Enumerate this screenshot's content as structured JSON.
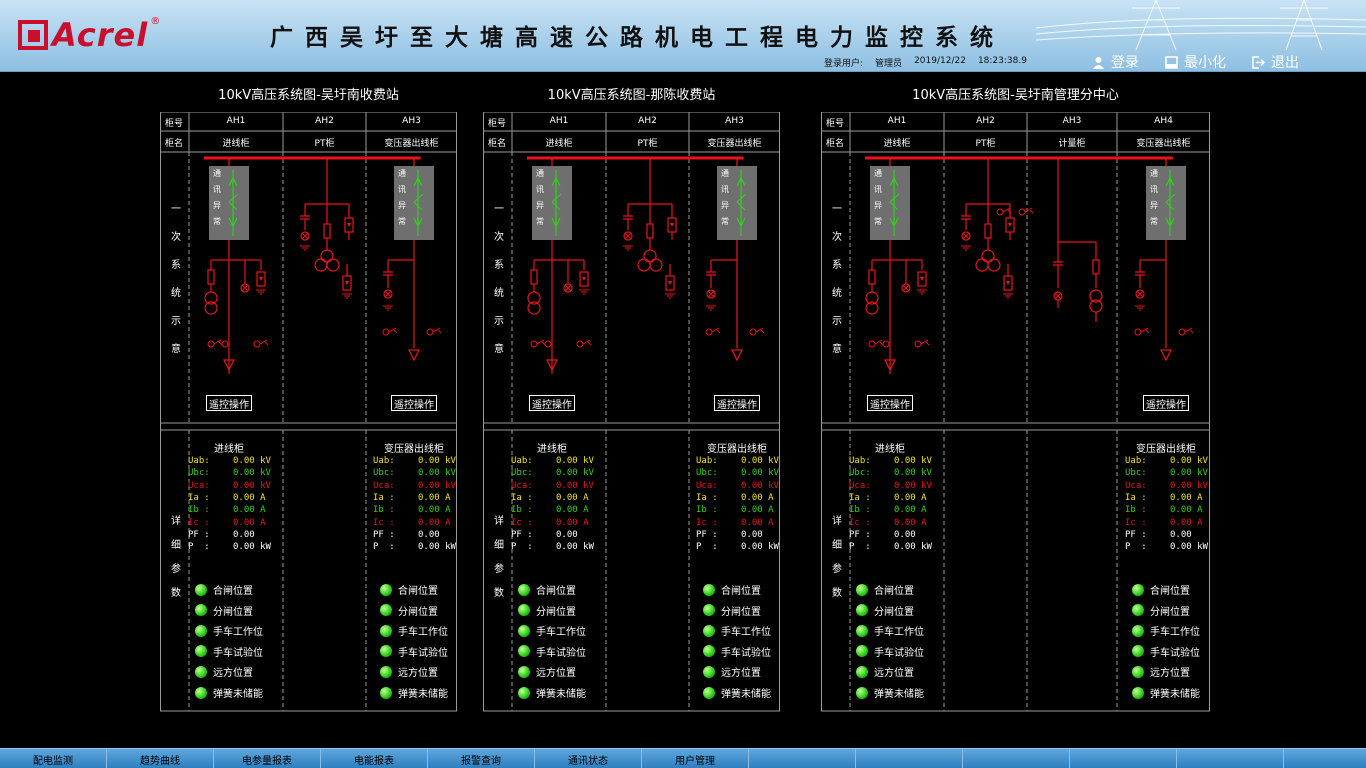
{
  "header": {
    "logo_text": "Acrel",
    "logo_reg": "®",
    "title": "广西吴圩至大塘高速公路机电工程电力监控系统",
    "login_label": "登录用户:",
    "login_user": "管理员",
    "date": "2019/12/22",
    "time": "18:23:38.9",
    "btn_login": "登录",
    "btn_minimize": "最小化",
    "btn_exit": "退出"
  },
  "colors": {
    "line": "#e8141c",
    "measGreen": "#2fd21a",
    "ledGreen": "#2fd21a",
    "accent": "#c8102e",
    "nav": "#2e7fc0"
  },
  "common": {
    "row_cabinet_no": "柜号",
    "row_cabinet_name": "柜名",
    "primary_label": [
      "一",
      "次",
      "系",
      "统",
      "示",
      "意"
    ],
    "detail_label": [
      "详",
      "细",
      "参",
      "数"
    ],
    "comm_fault": [
      "通",
      "讯",
      "异",
      "常"
    ],
    "remote_btn": "遥控操作"
  },
  "panels": [
    {
      "title": "10kV高压系统图-吴圩南收费站",
      "cabinets": [
        {
          "no": "AH1",
          "name": "进线柜"
        },
        {
          "no": "AH2",
          "name": "PT柜"
        },
        {
          "no": "AH3",
          "name": "变压器出线柜"
        }
      ],
      "details": [
        {
          "title": "进线柜",
          "meas": [
            {
              "label": "Uab:",
              "value": "0.00 kV"
            },
            {
              "label": "Ubc:",
              "value": "0.00 kV"
            },
            {
              "label": "Uca:",
              "value": "0.00 kV"
            },
            {
              "label": "Ia :",
              "value": "0.00 A"
            },
            {
              "label": "Ib :",
              "value": "0.00 A"
            },
            {
              "label": "Ic :",
              "value": "0.00 A"
            },
            {
              "label": "PF :",
              "value": "0.00"
            },
            {
              "label": "P  :",
              "value": "0.00 kW"
            }
          ],
          "status": [
            "合闸位置",
            "分闸位置",
            "手车工作位",
            "手车试验位",
            "远方位置",
            "弹簧未储能"
          ]
        },
        {
          "title": "变压器出线柜",
          "meas": [
            {
              "label": "Uab:",
              "value": "0.00 kV"
            },
            {
              "label": "Ubc:",
              "value": "0.00 kV"
            },
            {
              "label": "Uca:",
              "value": "0.00 kV"
            },
            {
              "label": "Ia :",
              "value": "0.00 A"
            },
            {
              "label": "Ib :",
              "value": "0.00 A"
            },
            {
              "label": "Ic :",
              "value": "0.00 A"
            },
            {
              "label": "PF :",
              "value": "0.00"
            },
            {
              "label": "P  :",
              "value": "0.00 kW"
            }
          ],
          "status": [
            "合闸位置",
            "分闸位置",
            "手车工作位",
            "手车试验位",
            "远方位置",
            "弹簧未储能"
          ]
        }
      ]
    },
    {
      "title": "10kV高压系统图-那陈收费站",
      "cabinets": [
        {
          "no": "AH1",
          "name": "进线柜"
        },
        {
          "no": "AH2",
          "name": "PT柜"
        },
        {
          "no": "AH3",
          "name": "变压器出线柜"
        }
      ],
      "details": [
        {
          "title": "进线柜",
          "meas": [
            {
              "label": "Uab:",
              "value": "0.00 kV"
            },
            {
              "label": "Ubc:",
              "value": "0.00 kV"
            },
            {
              "label": "Uca:",
              "value": "0.00 kV"
            },
            {
              "label": "Ia :",
              "value": "0.00 A"
            },
            {
              "label": "Ib :",
              "value": "0.00 A"
            },
            {
              "label": "Ic :",
              "value": "0.00 A"
            },
            {
              "label": "PF :",
              "value": "0.00"
            },
            {
              "label": "P  :",
              "value": "0.00 kW"
            }
          ],
          "status": [
            "合闸位置",
            "分闸位置",
            "手车工作位",
            "手车试验位",
            "远方位置",
            "弹簧未储能"
          ]
        },
        {
          "title": "变压器出线柜",
          "meas": [
            {
              "label": "Uab:",
              "value": "0.00 kV"
            },
            {
              "label": "Ubc:",
              "value": "0.00 kV"
            },
            {
              "label": "Uca:",
              "value": "0.00 kV"
            },
            {
              "label": "Ia :",
              "value": "0.00 A"
            },
            {
              "label": "Ib :",
              "value": "0.00 A"
            },
            {
              "label": "Ic :",
              "value": "0.00 A"
            },
            {
              "label": "PF :",
              "value": "0.00"
            },
            {
              "label": "P  :",
              "value": "0.00 kW"
            }
          ],
          "status": [
            "合闸位置",
            "分闸位置",
            "手车工作位",
            "手车试验位",
            "远方位置",
            "弹簧未储能"
          ]
        }
      ]
    },
    {
      "title": "10kV高压系统图-吴圩南管理分中心",
      "cabinets": [
        {
          "no": "AH1",
          "name": "进线柜"
        },
        {
          "no": "AH2",
          "name": "PT柜"
        },
        {
          "no": "AH3",
          "name": "计量柜"
        },
        {
          "no": "AH4",
          "name": "变压器出线柜"
        }
      ],
      "details": [
        {
          "title": "进线柜",
          "meas": [
            {
              "label": "Uab:",
              "value": "0.00 kV"
            },
            {
              "label": "Ubc:",
              "value": "0.00 kV"
            },
            {
              "label": "Uca:",
              "value": "0.00 kV"
            },
            {
              "label": "Ia :",
              "value": "0.00 A"
            },
            {
              "label": "Ib :",
              "value": "0.00 A"
            },
            {
              "label": "Ic :",
              "value": "0.00 A"
            },
            {
              "label": "PF :",
              "value": "0.00"
            },
            {
              "label": "P  :",
              "value": "0.00 kW"
            }
          ],
          "status": [
            "合闸位置",
            "分闸位置",
            "手车工作位",
            "手车试验位",
            "远方位置",
            "弹簧未储能"
          ]
        },
        {
          "title": "变压器出线柜",
          "meas": [
            {
              "label": "Uab:",
              "value": "0.00 kV"
            },
            {
              "label": "Ubc:",
              "value": "0.00 kV"
            },
            {
              "label": "Uca:",
              "value": "0.00 kV"
            },
            {
              "label": "Ia :",
              "value": "0.00 A"
            },
            {
              "label": "Ib :",
              "value": "0.00 A"
            },
            {
              "label": "Ic :",
              "value": "0.00 A"
            },
            {
              "label": "PF :",
              "value": "0.00"
            },
            {
              "label": "P  :",
              "value": "0.00 kW"
            }
          ],
          "status": [
            "合闸位置",
            "分闸位置",
            "手车工作位",
            "手车试验位",
            "远方位置",
            "弹簧未储能"
          ]
        }
      ]
    }
  ],
  "nav": [
    "配电监测",
    "趋势曲线",
    "电参量报表",
    "电能报表",
    "报警查询",
    "通讯状态",
    "用户管理"
  ]
}
